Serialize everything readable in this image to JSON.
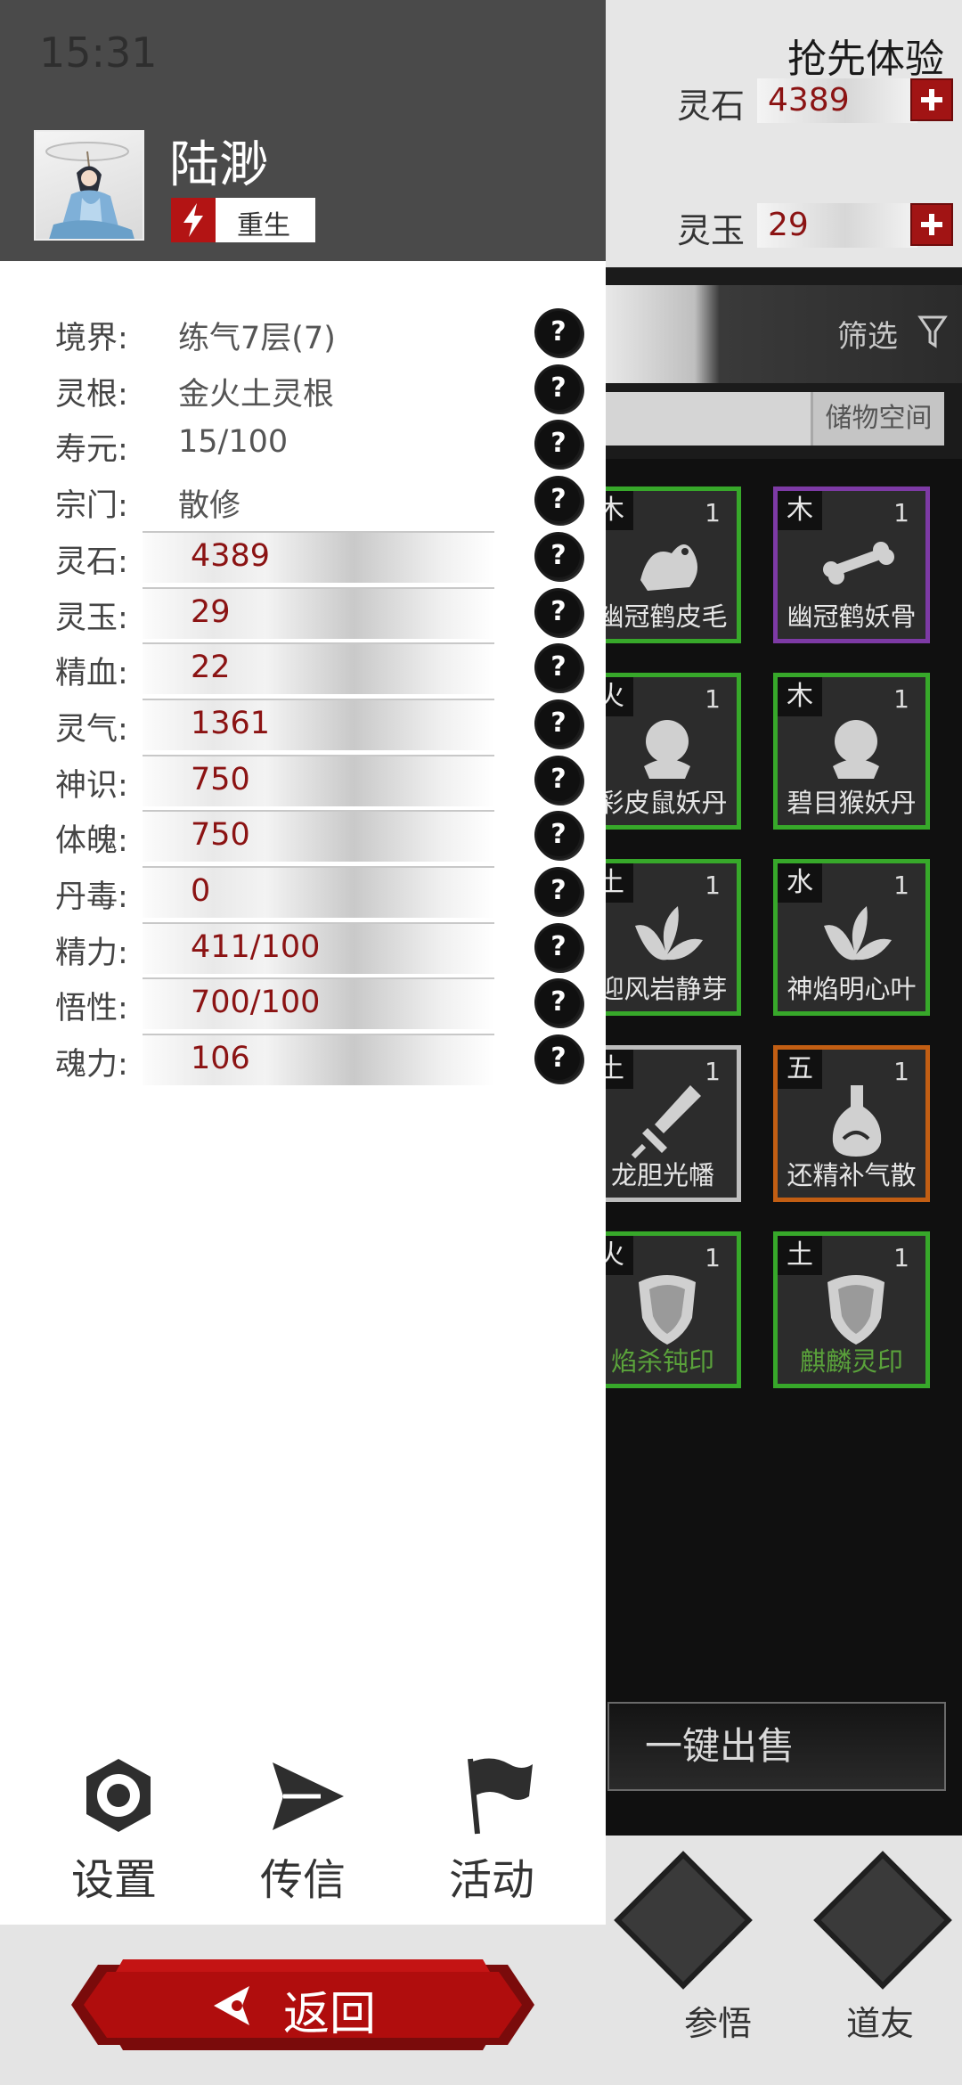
{
  "status": {
    "time": "15:31"
  },
  "player": {
    "name": "陆渺",
    "tag": "重生"
  },
  "stats": [
    {
      "label": "境界:",
      "value": "练气7层(7)",
      "bar": false
    },
    {
      "label": "灵根:",
      "value": "金火土灵根",
      "bar": false
    },
    {
      "label": "寿元:",
      "value": "15/100",
      "bar": false
    },
    {
      "label": "宗门:",
      "value": "散修",
      "bar": false
    },
    {
      "label": "灵石:",
      "value": "4389",
      "bar": true
    },
    {
      "label": "灵玉:",
      "value": "29",
      "bar": true
    },
    {
      "label": "精血:",
      "value": "22",
      "bar": true
    },
    {
      "label": "灵气:",
      "value": "1361",
      "bar": true
    },
    {
      "label": "神识:",
      "value": "750",
      "bar": true
    },
    {
      "label": "体魄:",
      "value": "750",
      "bar": true
    },
    {
      "label": "丹毒:",
      "value": "0",
      "bar": true
    },
    {
      "label": "精力:",
      "value": "411/100",
      "bar": true
    },
    {
      "label": "悟性:",
      "value": "700/100",
      "bar": true
    },
    {
      "label": "魂力:",
      "value": "106",
      "bar": true
    }
  ],
  "help_glyph": "?",
  "actions": [
    {
      "label": "设置",
      "icon": "gear-icon"
    },
    {
      "label": "传信",
      "icon": "send-icon"
    },
    {
      "label": "活动",
      "icon": "flag-icon"
    }
  ],
  "back_label": "返回",
  "right_panel": {
    "title": "抢先体验",
    "resources": [
      {
        "name": "灵石",
        "value": "4389"
      },
      {
        "name": "灵玉",
        "value": "29"
      }
    ],
    "filter_label": "筛选",
    "storage_label": "储物空间",
    "items": [
      {
        "element": "木",
        "qty": "1",
        "name": "幽冠鹤皮毛",
        "rarity": "green",
        "icon": "pelt-icon"
      },
      {
        "element": "木",
        "qty": "1",
        "name": "幽冠鹤妖骨",
        "rarity": "purple",
        "icon": "bone-icon"
      },
      {
        "element": "火",
        "qty": "1",
        "name": "彩皮鼠妖丹",
        "rarity": "green",
        "icon": "orb-icon"
      },
      {
        "element": "木",
        "qty": "1",
        "name": "碧目猴妖丹",
        "rarity": "green",
        "icon": "orb-icon"
      },
      {
        "element": "土",
        "qty": "1",
        "name": "迎风岩静芽",
        "rarity": "green",
        "icon": "leaf-icon"
      },
      {
        "element": "水",
        "qty": "1",
        "name": "神焰明心叶",
        "rarity": "green",
        "icon": "leaf-icon"
      },
      {
        "element": "土",
        "qty": "1",
        "name": "龙胆光幡",
        "rarity": "white",
        "icon": "sword-icon"
      },
      {
        "element": "五",
        "qty": "1",
        "name": "还精补气散",
        "rarity": "orange",
        "icon": "potion-icon"
      },
      {
        "element": "火",
        "qty": "1",
        "name": "焰杀钝印",
        "rarity": "green",
        "icon": "shield-icon"
      },
      {
        "element": "土",
        "qty": "1",
        "name": "麒麟灵印",
        "rarity": "green",
        "icon": "shield-icon"
      }
    ],
    "sell_label": "一键出售",
    "nav": [
      {
        "label": "参悟"
      },
      {
        "label": "道友"
      }
    ],
    "colors": {
      "green": "#37a82a",
      "purple": "#7d3aa5",
      "white": "#bdbdbd",
      "orange": "#c25e13",
      "value_red": "#8b1313",
      "accent_red": "#a11414"
    }
  }
}
